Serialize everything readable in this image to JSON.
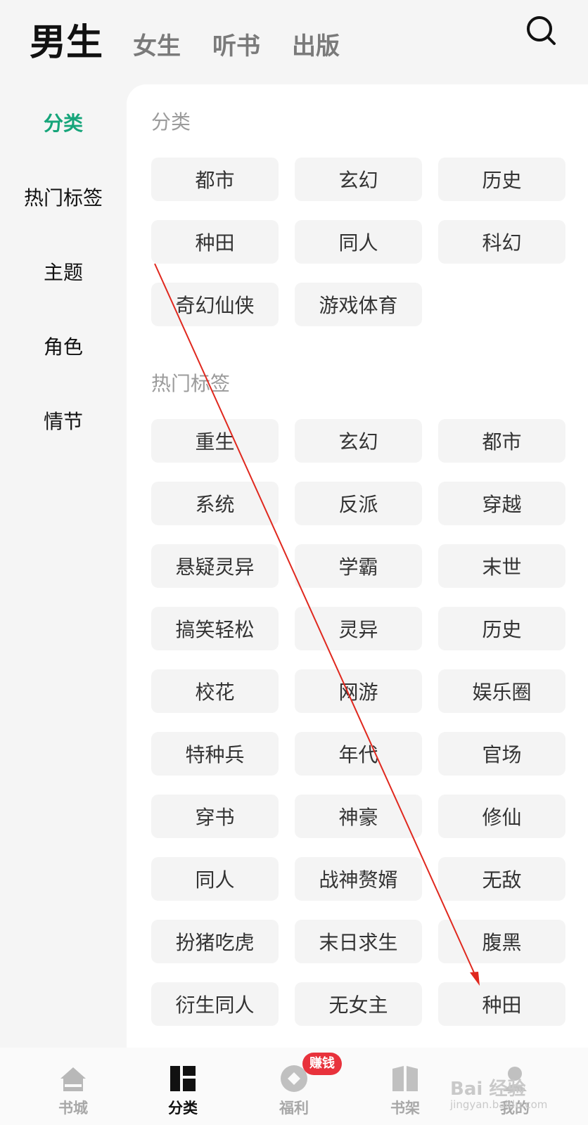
{
  "top_tabs": {
    "active": "男生",
    "tab_1": "女生",
    "tab_2": "听书",
    "tab_3": "出版"
  },
  "search_icon": "search-icon",
  "sidebar": {
    "items": [
      "分类",
      "热门标签",
      "主题",
      "角色",
      "情节"
    ],
    "active_color": "#16a57a"
  },
  "sections": {
    "category": {
      "title": "分类",
      "tags": [
        "都市",
        "玄幻",
        "历史",
        "种田",
        "同人",
        "科幻",
        "奇幻仙侠",
        "游戏体育"
      ]
    },
    "hot_tags": {
      "title": "热门标签",
      "tags": [
        "重生",
        "玄幻",
        "都市",
        "系统",
        "反派",
        "穿越",
        "悬疑灵异",
        "学霸",
        "末世",
        "搞笑轻松",
        "灵异",
        "历史",
        "校花",
        "网游",
        "娱乐圈",
        "特种兵",
        "年代",
        "官场",
        "穿书",
        "神豪",
        "修仙",
        "同人",
        "战神赘婿",
        "无敌",
        "扮猪吃虎",
        "末日求生",
        "腹黑",
        "衍生同人",
        "无女主",
        "种田"
      ]
    }
  },
  "bottom_nav": {
    "items": [
      {
        "label": "书城",
        "icon": "home-icon"
      },
      {
        "label": "分类",
        "icon": "category-grid-icon"
      },
      {
        "label": "福利",
        "icon": "coin-icon"
      },
      {
        "label": "书架",
        "icon": "bookshelf-icon"
      },
      {
        "label": "我的",
        "icon": "profile-icon"
      }
    ],
    "badge": "赚钱",
    "badge_color": "#e8323c"
  },
  "watermark": {
    "main": "Bai 经验",
    "sub": "jingyan.baidu.com"
  },
  "annotation_color": "#e0281e"
}
